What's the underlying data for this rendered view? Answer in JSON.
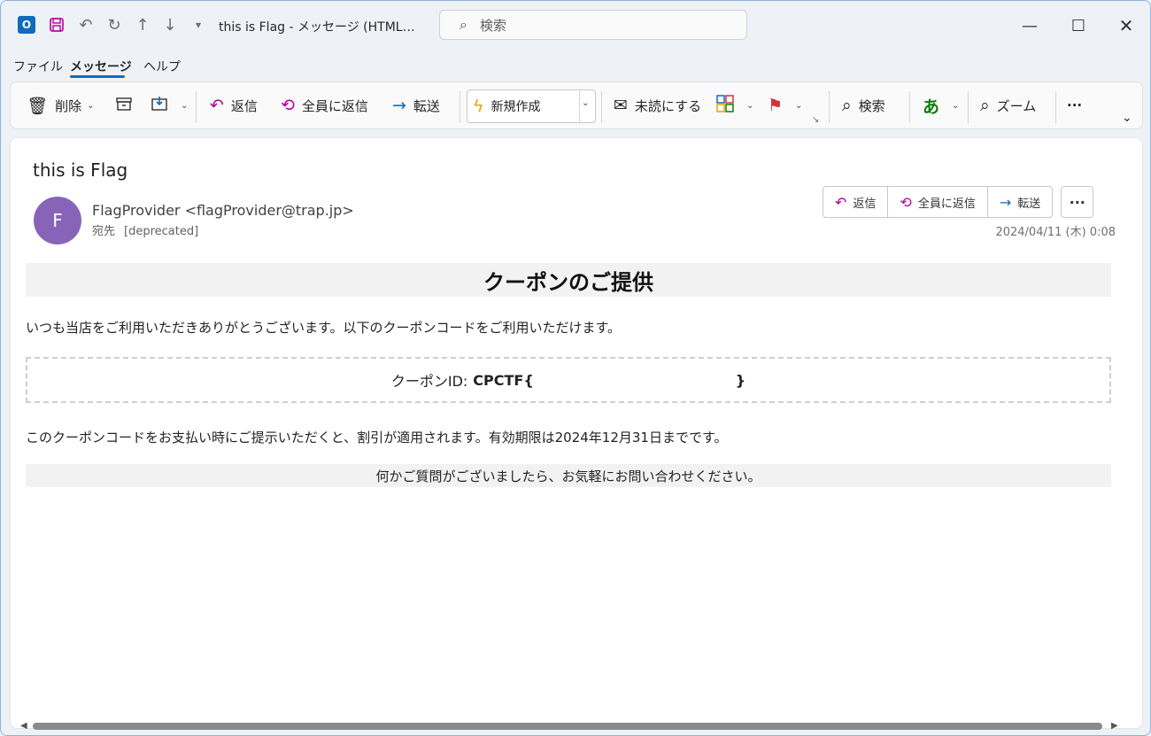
{
  "window": {
    "title": "this is Flag  -  メッセージ (HTML…",
    "search_placeholder": "検索",
    "controls": {
      "minimize": "—",
      "maximize": "☐",
      "close": "✕"
    }
  },
  "quick_access": {
    "icons": [
      "outlook-app-icon",
      "save-icon",
      "undo-icon",
      "redo-icon",
      "up-icon",
      "down-icon",
      "customize-icon"
    ]
  },
  "menu_tabs": [
    {
      "label": "ファイル",
      "active": false
    },
    {
      "label": "メッセージ",
      "active": true
    },
    {
      "label": "ヘルプ",
      "active": false
    }
  ],
  "ribbon": {
    "delete": "削除",
    "reply": "返信",
    "reply_all": "全員に返信",
    "forward": "転送",
    "new": "新規作成",
    "mark_unread": "未読にする",
    "search": "検索",
    "zoom": "ズーム",
    "more": "···"
  },
  "message": {
    "subject": "this is Flag",
    "avatar_initial": "F",
    "avatar_color": "#8764b8",
    "sender": "FlagProvider <flagProvider@trap.jp>",
    "to_label": "宛先",
    "to_value": "[deprecated]",
    "date": "2024/04/11 (木) 0:08",
    "actions": {
      "reply": "返信",
      "reply_all": "全員に返信",
      "forward": "転送",
      "more": "···"
    }
  },
  "body": {
    "heading": "クーポンのご提供",
    "paragraph1": "いつも当店をご利用いただきありがとうございます。以下のクーポンコードをご利用いただけます。",
    "coupon_label": "クーポンID:",
    "coupon_value": "CPCTF{",
    "coupon_end": "}",
    "paragraph2": "このクーポンコードをお支払い時にご提示いただくと、割引が適用されます。有効期限は2024年12月31日までです。",
    "footer": "何かご質問がございましたら、お気軽にお問い合わせください。"
  },
  "colors": {
    "accent": "#0f6cbd",
    "avatar": "#8764b8",
    "flag": "#d13438"
  }
}
